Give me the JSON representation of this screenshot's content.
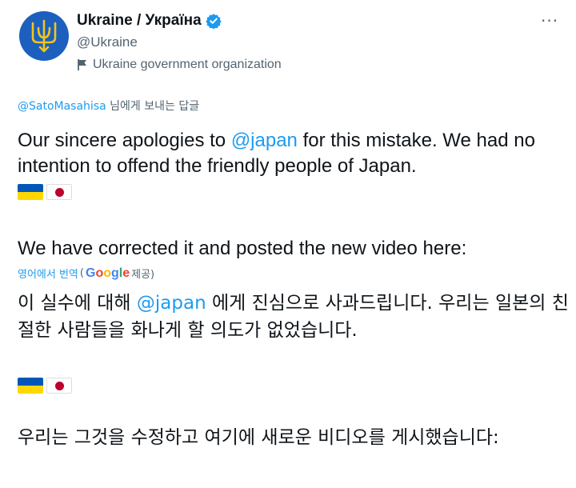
{
  "account": {
    "display_name": "Ukraine / Україна",
    "handle": "@Ukraine",
    "label": "Ukraine government organization",
    "verified": true,
    "avatar_color": "#1c5fbf",
    "verified_color": "#1d9bf0"
  },
  "more_label": "···",
  "reply": {
    "mention": "@SatoMasahisa",
    "suffix": " 님에게 보내는 답글"
  },
  "tweet": {
    "p1_before": "Our sincere apologies to ",
    "p1_mention": "@japan",
    "p1_after": " for this mistake. We had no intention to offend the friendly people of Japan.",
    "p2": "We have corrected it and posted the new video here:"
  },
  "translation": {
    "label": "영어에서 번역",
    "provider_open": "(",
    "provider_name": "Google",
    "provider_close": " 제공)",
    "p1_before": "이 실수에 대해 ",
    "p1_mention": "@japan",
    "p1_after": " 에게 진심으로 사과드립니다. 우리는 일본의 친절한 사람들을 화나게 할 의도가 없었습니다.",
    "p2": " 우리는 그것을 수정하고 여기에 새로운 비디오를 게시했습니다:"
  },
  "flags": [
    "ukraine-flag",
    "japan-flag"
  ],
  "colors": {
    "link": "#1d9bf0",
    "secondary_text": "#536471",
    "primary_text": "#0f1419"
  }
}
